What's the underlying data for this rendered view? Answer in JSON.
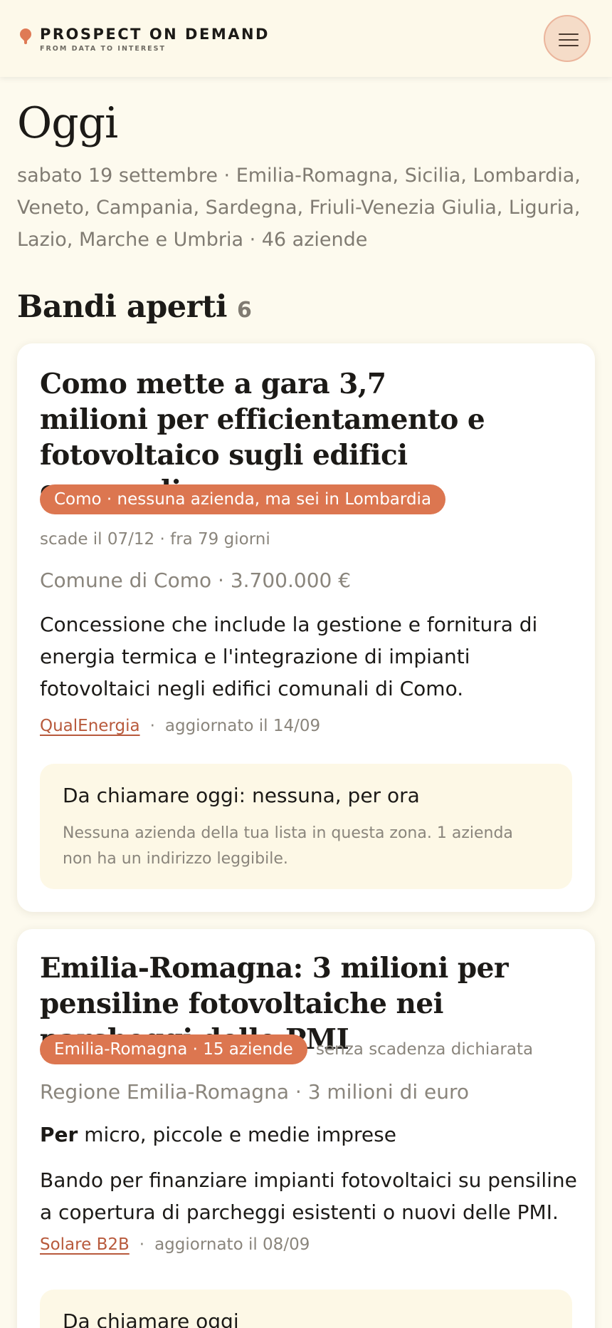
{
  "brand": {
    "name": "PROSPECT ON DEMAND",
    "tagline": "FROM DATA TO INTEREST",
    "logo_icon": "pin-icon"
  },
  "header": {
    "menu_icon": "hamburger-menu-icon"
  },
  "page": {
    "title": "Oggi",
    "subtitle": "sabato 19 settembre · Emilia-Romagna, Sicilia, Lombardia, Veneto, Campania, Sardegna, Friuli-Venezia Giulia, Liguria, Lazio, Marche e Umbria · 46 aziende"
  },
  "section": {
    "title": "Bandi aperti",
    "count": "6"
  },
  "cards": [
    {
      "title": "Como mette a gara 3,7 milioni per efficientamento e fotovoltaico sugli edifici comunali",
      "badge": "Como · nessuna azienda, ma sei in Lombardia",
      "deadline": "scade il 07/12 · fra 79 giorni",
      "entity": "Comune di Como · 3.700.000 €",
      "description": "Concessione che include la gestione e fornitura di energia termica e l'integrazione di impianti fotovoltaici negli edifici comunali di Como.",
      "source": "QualEnergia",
      "updated": "aggiornato il 14/09",
      "call_title": "Da chiamare oggi: nessuna, per ora",
      "call_note": "Nessuna azienda della tua lista in questa zona. 1 azienda non ha un indirizzo leggibile."
    },
    {
      "title": "Emilia-Romagna: 3 milioni per pensiline fotovoltaiche nei parcheggi delle PMI",
      "badge": "Emilia-Romagna · 15 aziende",
      "deadline": "senza scadenza dichiarata",
      "entity": "Regione Emilia-Romagna · 3 milioni di euro",
      "audience_prefix": "Per",
      "audience": "micro, piccole e medie imprese",
      "description": "Bando per finanziare impianti fotovoltaici su pensiline a copertura di parcheggi esistenti o nuovi delle PMI.",
      "source": "Solare B2B",
      "updated": "aggiornato il 08/09",
      "call_title": "Da chiamare oggi"
    }
  ],
  "colors": {
    "background": "#fdfaee",
    "accent": "#dc7650",
    "link": "#b85a3c",
    "muted": "#8a857c"
  }
}
